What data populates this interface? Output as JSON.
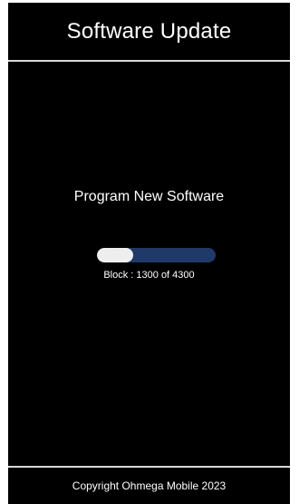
{
  "header": {
    "title": "Software Update"
  },
  "main": {
    "title": "Program New Software",
    "progress": {
      "current": 1300,
      "total": 4300,
      "fraction": 0.302,
      "label": "Block : 1300 of 4300"
    }
  },
  "footer": {
    "text": "Copyright Ohmega Mobile 2023"
  },
  "colors": {
    "background": "#000000",
    "text": "#ffffff",
    "progress_track": "#1f3a68",
    "progress_fill": "#eeeeee",
    "divider": "#d9d9d9"
  }
}
